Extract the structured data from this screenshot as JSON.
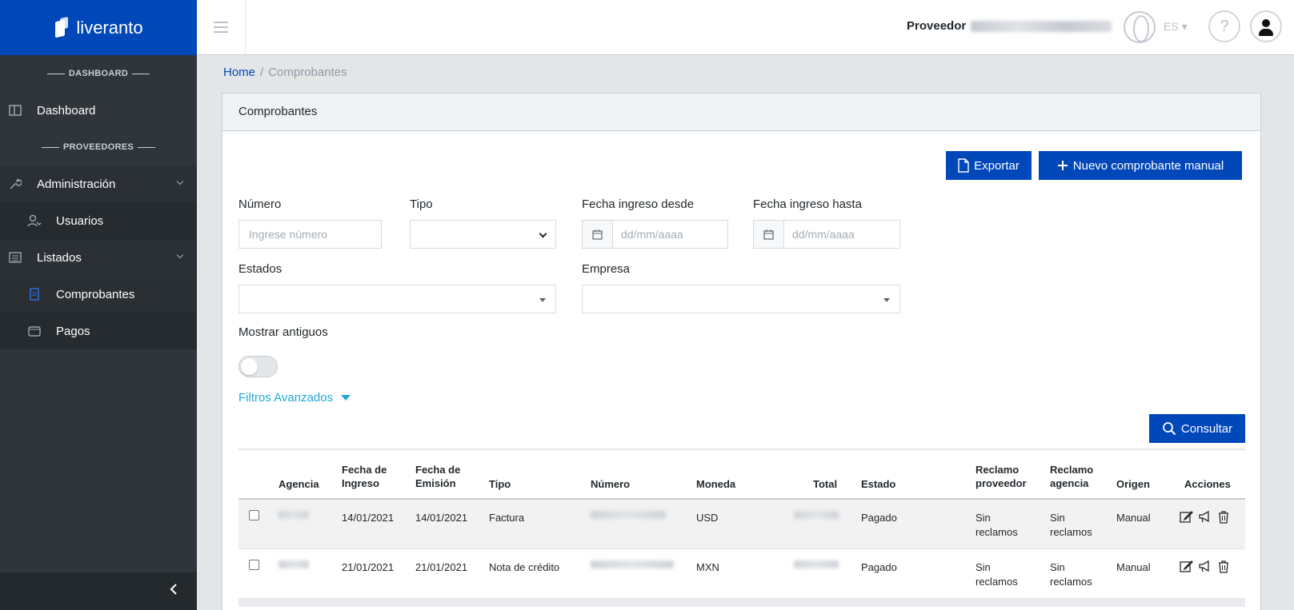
{
  "brand": {
    "name": "liveranto",
    "color": "#0047ba"
  },
  "sidebar": {
    "sections": [
      {
        "title": "DASHBOARD"
      },
      {
        "title": "PROVEEDORES"
      }
    ],
    "items": [
      {
        "label": "Dashboard",
        "icon": "dashboard-icon"
      },
      {
        "label": "Administración",
        "icon": "wrench-icon"
      },
      {
        "label": "Usuarios",
        "icon": "users-icon"
      },
      {
        "label": "Listados",
        "icon": "list-icon"
      },
      {
        "label": "Comprobantes",
        "icon": "document-icon"
      },
      {
        "label": "Pagos",
        "icon": "wallet-icon"
      }
    ],
    "toggle_icon": "chevron-left-icon"
  },
  "header": {
    "provider_label": "Proveedor",
    "language": "ES"
  },
  "breadcrumb": {
    "home": "Home",
    "current": "Comprobantes"
  },
  "card": {
    "title": "Comprobantes",
    "export_label": "Exportar",
    "new_label": "Nuevo comprobante manual",
    "consult_label": "Consultar"
  },
  "filters": {
    "numero_label": "Número",
    "numero_placeholder": "Ingrese número",
    "tipo_label": "Tipo",
    "fecha_desde_label": "Fecha ingreso desde",
    "fecha_hasta_label": "Fecha ingreso hasta",
    "date_placeholder": "dd/mm/aaaa",
    "estados_label": "Estados",
    "empresa_label": "Empresa",
    "mostrar_antiguos_label": "Mostrar antiguos",
    "mostrar_antiguos_on": false,
    "advanced_label": "Filtros Avanzados"
  },
  "table": {
    "headers": {
      "agencia": "Agencia",
      "fecha_ingreso_1": "Fecha de",
      "fecha_ingreso_2": "Ingreso",
      "fecha_emision_1": "Fecha de",
      "fecha_emision_2": "Emisión",
      "tipo": "Tipo",
      "numero": "Número",
      "moneda": "Moneda",
      "total": "Total",
      "estado": "Estado",
      "reclamo_prov_1": "Reclamo",
      "reclamo_prov_2": "proveedor",
      "reclamo_ag_1": "Reclamo",
      "reclamo_ag_2": "agencia",
      "origen": "Origen",
      "acciones": "Acciones"
    },
    "rows": [
      {
        "fecha_ingreso": "14/01/2021",
        "fecha_emision": "14/01/2021",
        "tipo": "Factura",
        "moneda": "USD",
        "estado": "Pagado",
        "reclamo_prov_1": "Sin",
        "reclamo_prov_2": "reclamos",
        "reclamo_ag_1": "Sin",
        "reclamo_ag_2": "reclamos",
        "origen": "Manual"
      },
      {
        "fecha_ingreso": "21/01/2021",
        "fecha_emision": "21/01/2021",
        "tipo": "Nota de crédito",
        "moneda": "MXN",
        "estado": "Pagado",
        "reclamo_prov_1": "Sin",
        "reclamo_prov_2": "reclamos",
        "reclamo_ag_1": "Sin",
        "reclamo_ag_2": "reclamos",
        "origen": "Manual"
      }
    ]
  }
}
